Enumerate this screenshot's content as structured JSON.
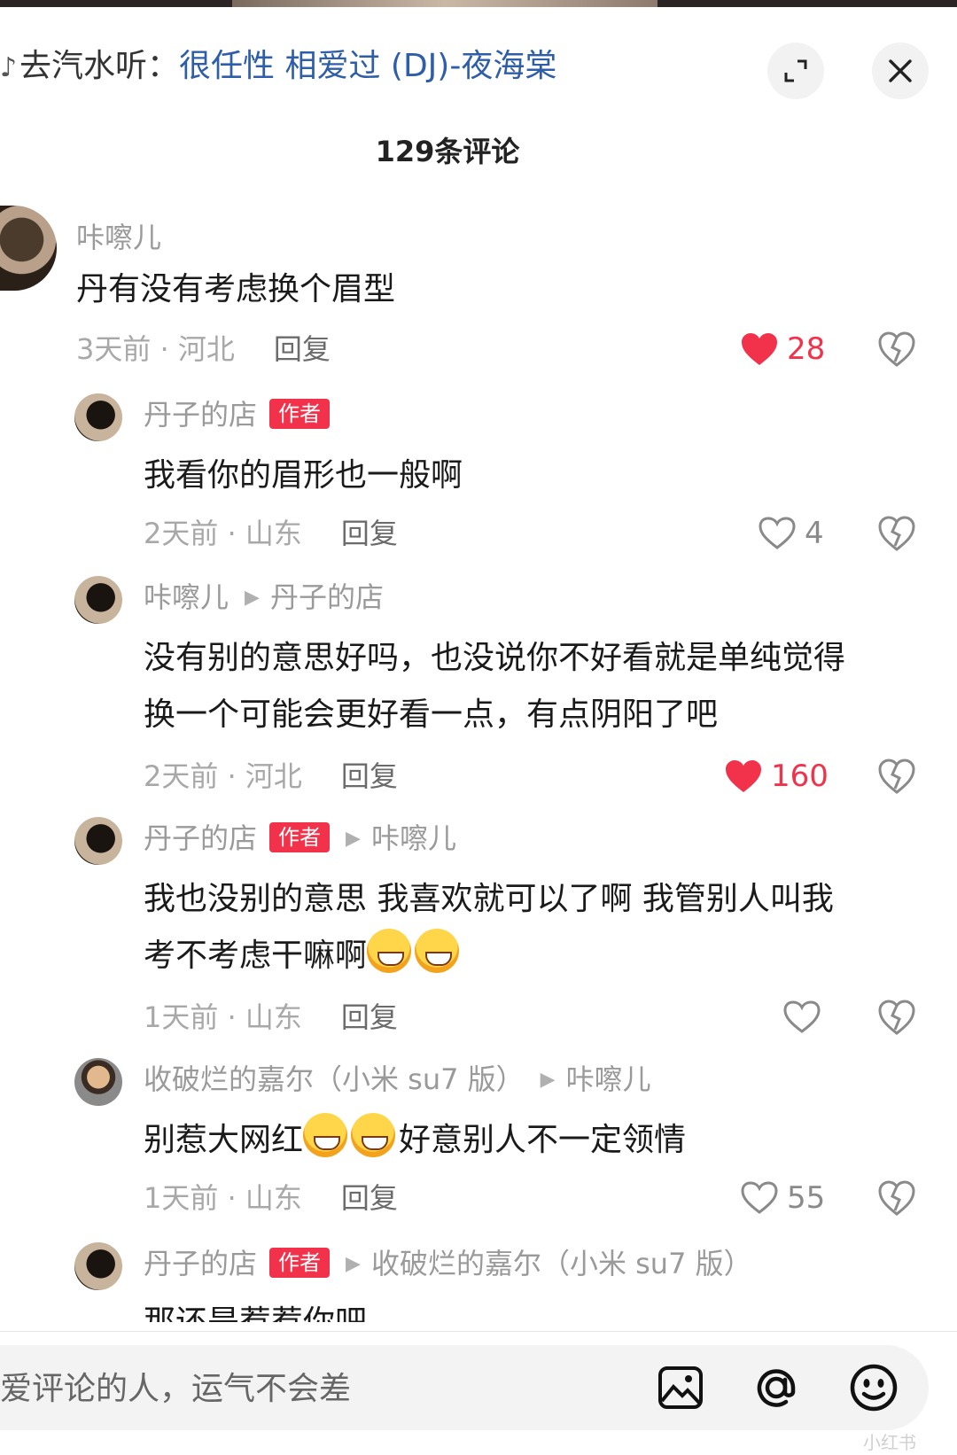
{
  "header": {
    "music_prefix": "去汽水听：",
    "song": "很任性 相爱过 (DJ)-夜海棠"
  },
  "comment_count": "129条评论",
  "comments": [
    {
      "user": "咔嚓儿",
      "text": "丹有没有考虑换个眉型",
      "time": "3天前 · 河北",
      "reply": "回复",
      "likes": "28",
      "liked": true
    },
    {
      "user": "丹子的店",
      "badge": "作者",
      "text": "我看你的眉形也一般啊",
      "time": "2天前 · 山东",
      "reply": "回复",
      "likes": "4",
      "liked": false
    },
    {
      "user": "咔嚓儿",
      "reply_to": "丹子的店",
      "text_line1": "没有别的意思好吗，也没说你不好看就是单纯觉得",
      "text_line2": "换一个可能会更好看一点，有点阴阳了吧",
      "time": "2天前 · 河北",
      "reply": "回复",
      "likes": "160",
      "liked": true
    },
    {
      "user": "丹子的店",
      "badge": "作者",
      "reply_to": "咔嚓儿",
      "text_line1": "我也没别的意思 我喜欢就可以了啊 我管别人叫我",
      "text_line2": "考不考虑干嘛啊",
      "time": "1天前 · 山东",
      "reply": "回复",
      "likes": "",
      "liked": false
    },
    {
      "user": "收破烂的嘉尔（小米 su7 版）",
      "reply_to": "咔嚓儿",
      "text_a": "别惹大网红",
      "text_b": "好意别人不一定领情",
      "time": "1天前 · 山东",
      "reply": "回复",
      "likes": "55",
      "liked": false
    },
    {
      "user": "丹子的店",
      "badge": "作者",
      "reply_to": "收破烂的嘉尔（小米 su7 版）",
      "text": "那还是惹惹你吧"
    }
  ],
  "input": {
    "placeholder": "爱评论的人，运气不会差"
  },
  "icons": [
    "music-icon",
    "expand-icon",
    "close-icon",
    "heart-icon",
    "dislike-icon",
    "image-icon",
    "at-icon",
    "emoji-icon"
  ],
  "colors": {
    "accent": "#f2324a",
    "song_link": "#2f5ea8"
  },
  "watermark": "小红书"
}
